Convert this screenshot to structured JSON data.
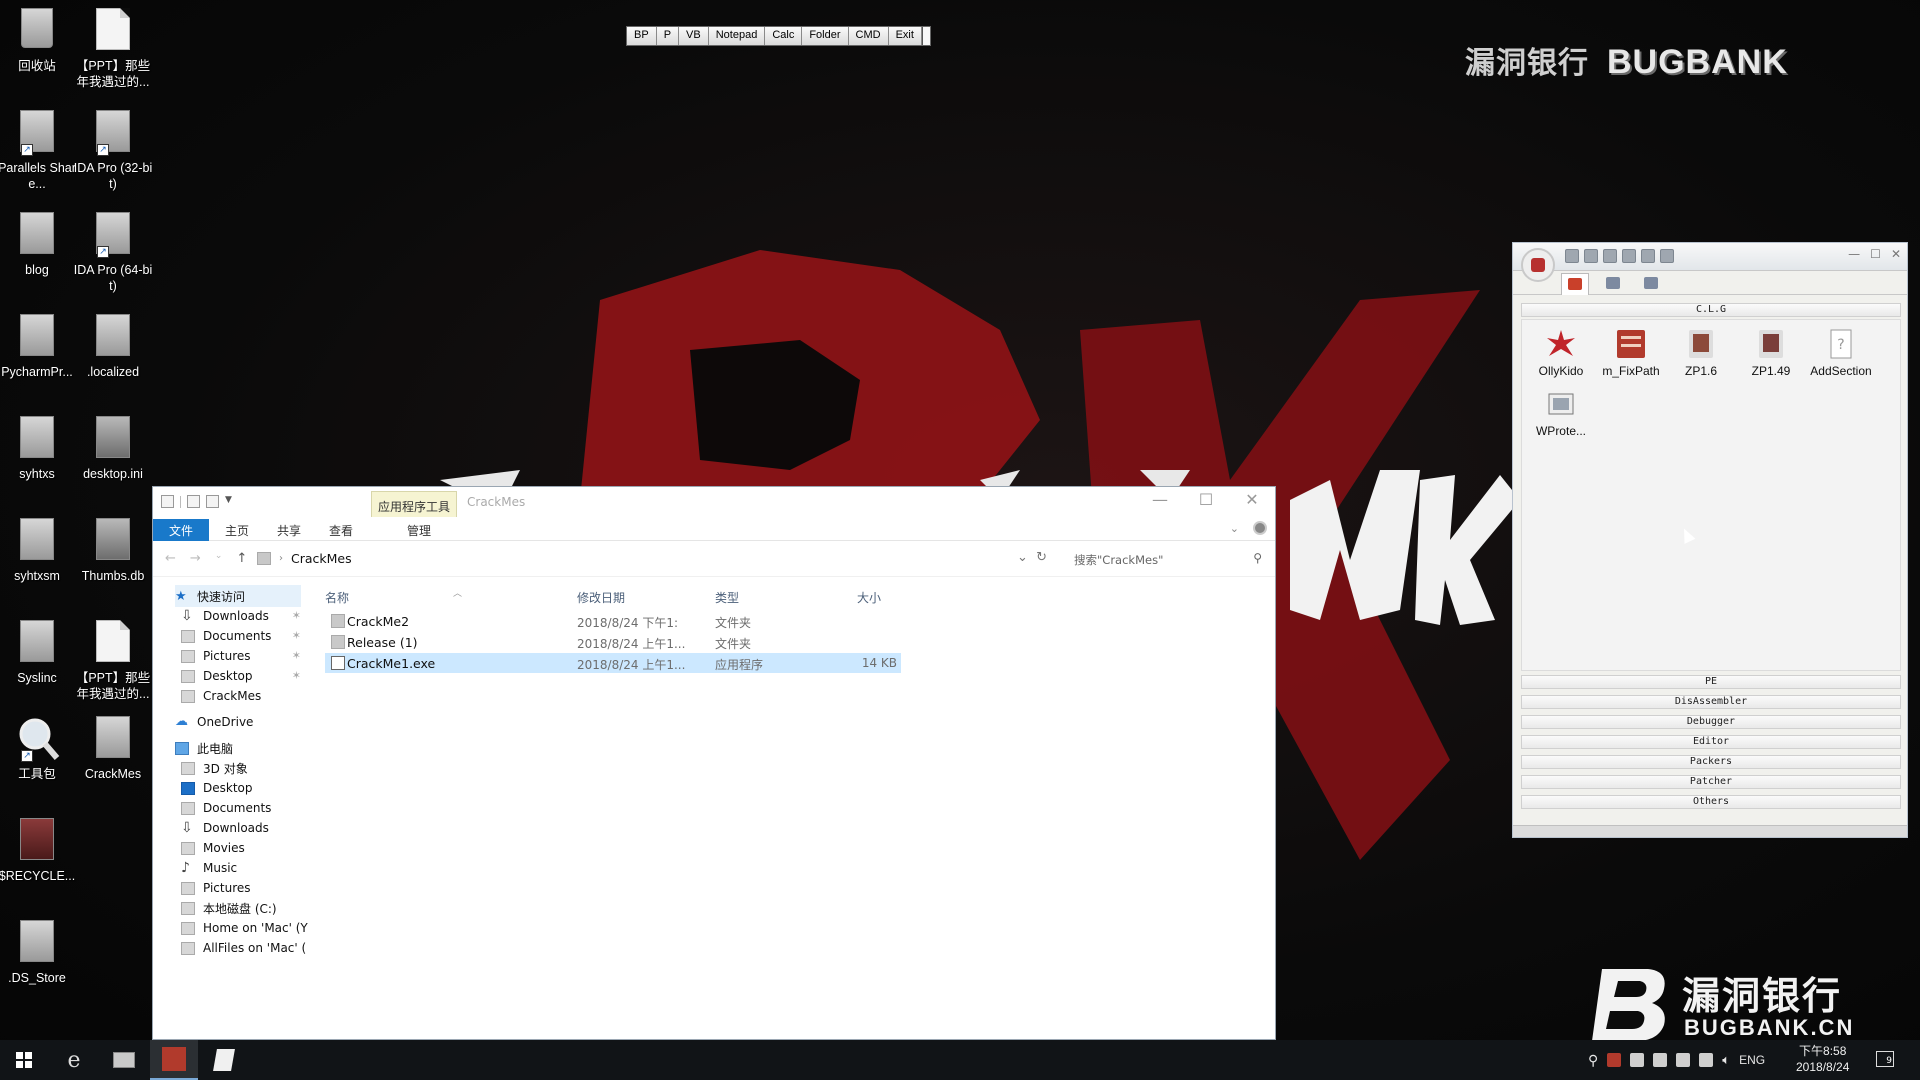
{
  "watermark": {
    "top_cn": "漏洞银行",
    "top_en": "BUGBANK",
    "bottom_cn": "漏洞银行",
    "bottom_en": "BUGBANK.CN"
  },
  "desktop_icons": [
    {
      "label": "回收站",
      "icon": "recycle-bin-icon"
    },
    {
      "label": "【PPT】那些年我遇过的...",
      "icon": "document-icon"
    },
    {
      "label": "Parallels Share...",
      "icon": "shared-folder-icon"
    },
    {
      "label": "IDA Pro (32-bit)",
      "icon": "ida-icon"
    },
    {
      "label": "blog",
      "icon": "folder-icon"
    },
    {
      "label": "IDA Pro (64-bit)",
      "icon": "ida-icon"
    },
    {
      "label": "PycharmPr...",
      "icon": "folder-icon"
    },
    {
      "label": ".localized",
      "icon": "file-icon"
    },
    {
      "label": "syhtxs",
      "icon": "folder-icon"
    },
    {
      "label": "desktop.ini",
      "icon": "settings-file-icon"
    },
    {
      "label": "syhtxsm",
      "icon": "folder-icon"
    },
    {
      "label": "Thumbs.db",
      "icon": "settings-file-icon"
    },
    {
      "label": "Syslinc",
      "icon": "folder-icon"
    },
    {
      "label": "【PPT】那些年我遇过的...",
      "icon": "document-icon"
    },
    {
      "label": "工具包",
      "icon": "magnifier-icon"
    },
    {
      "label": "CrackMes",
      "icon": "folder-icon"
    },
    {
      "label": "$RECYCLE...",
      "icon": "recycle-folder-icon"
    },
    {
      "label": ".DS_Store",
      "icon": "file-icon"
    }
  ],
  "quickbar": [
    "BP",
    "P",
    "VB",
    "Notepad",
    "Calc",
    "Folder",
    "CMD",
    "Exit"
  ],
  "explorer": {
    "context_tab": "应用程序工具",
    "title": "CrackMes",
    "ribbon_tabs": [
      "文件",
      "主页",
      "共享",
      "查看",
      "管理"
    ],
    "breadcrumb": "CrackMes",
    "search_placeholder": "搜索\"CrackMes\"",
    "columns": [
      "名称",
      "修改日期",
      "类型",
      "大小"
    ],
    "sidebar": [
      {
        "label": "快速访问",
        "kind": "star",
        "pinned": false
      },
      {
        "label": "Downloads",
        "kind": "dl",
        "pinned": true
      },
      {
        "label": "Documents",
        "kind": "doc",
        "pinned": true
      },
      {
        "label": "Pictures",
        "kind": "pic",
        "pinned": true
      },
      {
        "label": "Desktop",
        "kind": "folder",
        "pinned": true
      },
      {
        "label": "CrackMes",
        "kind": "folder",
        "pinned": false
      },
      {
        "label": "OneDrive",
        "kind": "cloud",
        "pinned": false
      },
      {
        "label": "此电脑",
        "kind": "pc",
        "pinned": false
      },
      {
        "label": "3D 对象",
        "kind": "folder",
        "pinned": false
      },
      {
        "label": "Desktop",
        "kind": "blue",
        "pinned": false
      },
      {
        "label": "Documents",
        "kind": "doc",
        "pinned": false
      },
      {
        "label": "Downloads",
        "kind": "dl",
        "pinned": false
      },
      {
        "label": "Movies",
        "kind": "folder",
        "pinned": false
      },
      {
        "label": "Music",
        "kind": "music",
        "pinned": false
      },
      {
        "label": "Pictures",
        "kind": "pic",
        "pinned": false
      },
      {
        "label": "本地磁盘 (C:)",
        "kind": "drive",
        "pinned": false
      },
      {
        "label": "Home on 'Mac' (Y",
        "kind": "drive",
        "pinned": false
      },
      {
        "label": "AllFiles on 'Mac' (",
        "kind": "drive",
        "pinned": false
      }
    ],
    "files": [
      {
        "name": "CrackMe2",
        "date": "2018/8/24 下午1:",
        "type": "文件夹",
        "size": "",
        "icon": "folder-icon",
        "selected": false
      },
      {
        "name": "Release (1)",
        "date": "2018/8/24 上午1...",
        "type": "文件夹",
        "size": "",
        "icon": "folder-icon",
        "selected": false
      },
      {
        "name": "CrackMe1.exe",
        "date": "2018/8/24 上午1...",
        "type": "应用程序",
        "size": "14 KB",
        "icon": "exe-icon",
        "selected": true
      }
    ]
  },
  "clg": {
    "header": "C.L.G",
    "apps": [
      {
        "label": "OllyKido",
        "color": "#c0242a"
      },
      {
        "label": "m_FixPath",
        "color": "#b13a2c"
      },
      {
        "label": "ZP1.6",
        "color": "#8c4a3a"
      },
      {
        "label": "ZP1.49",
        "color": "#7a3e3a"
      },
      {
        "label": "AddSection",
        "color": "#9a9a9a"
      },
      {
        "label": "WProte...",
        "color": "#9aa4b0"
      }
    ],
    "sections": [
      "PE",
      "DisAssembler",
      "Debugger",
      "Editor",
      "Packers",
      "Patcher",
      "Others"
    ]
  },
  "taskbar": {
    "lang": "ENG",
    "time": "下午8:58",
    "date": "2018/8/24",
    "notifications": "9"
  }
}
